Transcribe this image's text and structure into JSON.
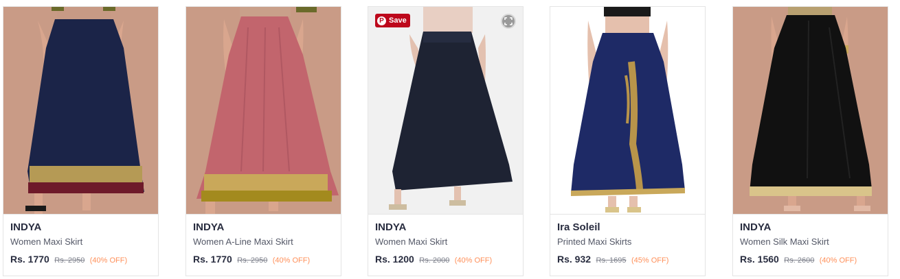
{
  "products": [
    {
      "brand": "INDYA",
      "name": "Women Maxi Skirt",
      "price": "Rs. 1770",
      "mrp": "Rs. 2950",
      "discount": "(40% OFF)",
      "colors": {
        "bg": "#c99b86",
        "skirt": "#1b2448",
        "border": "#b59a55",
        "hem": "#6e1a2a"
      }
    },
    {
      "brand": "INDYA",
      "name": "Women A-Line Maxi Skirt",
      "price": "Rs. 1770",
      "mrp": "Rs. 2950",
      "discount": "(40% OFF)",
      "colors": {
        "bg": "#c99b86",
        "skirt": "#c2656d",
        "border": "#c9a85a",
        "hem": "#a38a1e"
      }
    },
    {
      "brand": "INDYA",
      "name": "Women Maxi Skirt",
      "price": "Rs. 1200",
      "mrp": "Rs. 2000",
      "discount": "(40% OFF)",
      "save_label": "Save",
      "colors": {
        "bg": "#f1f1f1",
        "skirt": "#1e2333"
      }
    },
    {
      "brand": "Ira Soleil",
      "name": "Printed Maxi Skirts",
      "price": "Rs. 932",
      "mrp": "Rs. 1695",
      "discount": "(45% OFF)",
      "colors": {
        "bg": "#ffffff",
        "skirt": "#1e2a66",
        "border": "#c9a85a",
        "embroidery": "#b8944a"
      }
    },
    {
      "brand": "INDYA",
      "name": "Women Silk Maxi Skirt",
      "price": "Rs. 1560",
      "mrp": "Rs. 2600",
      "discount": "(40% OFF)",
      "colors": {
        "bg": "#c99b86",
        "skirt": "#111111",
        "border": "#d9c48a"
      }
    }
  ]
}
